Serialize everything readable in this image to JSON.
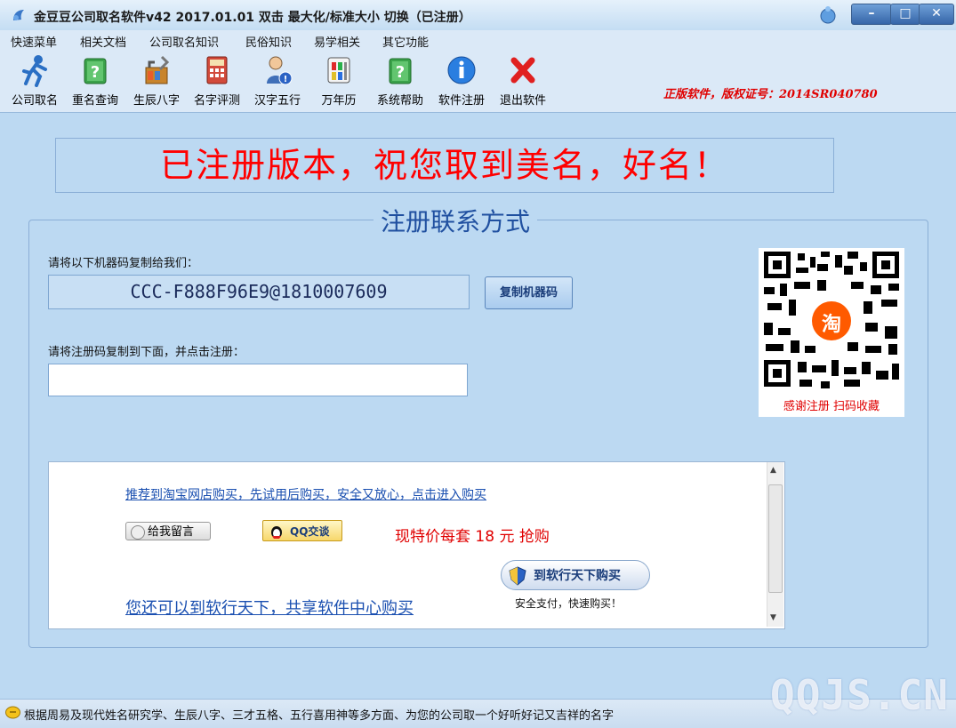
{
  "window": {
    "title": "金豆豆公司取名软件v42   2017.01.01  双击 最大化/标准大小 切换（已注册）"
  },
  "menu": [
    "快速菜单",
    "相关文档",
    "公司取名知识",
    "民俗知识",
    "易学相关",
    "其它功能"
  ],
  "toolbar": {
    "items": [
      {
        "label": "公司取名",
        "icon": "runner-icon"
      },
      {
        "label": "重名查询",
        "icon": "green-book-icon"
      },
      {
        "label": "生辰八字",
        "icon": "tools-icon"
      },
      {
        "label": "名字评测",
        "icon": "calculator-icon"
      },
      {
        "label": "汉字五行",
        "icon": "user-info-icon"
      },
      {
        "label": "万年历",
        "icon": "calendar-icon"
      },
      {
        "label": "系统帮助",
        "icon": "help-book-icon"
      },
      {
        "label": "软件注册",
        "icon": "info-icon"
      },
      {
        "label": "退出软件",
        "icon": "red-x-icon"
      }
    ],
    "copyright": "正版软件，版权证号：2014SR040780"
  },
  "banner": "已注册版本，祝您取到美名，好名！",
  "register": {
    "group_title": "注册联系方式",
    "machine_label": "请将以下机器码复制给我们：",
    "machine_code": "CCC-F888F96E9@1810007609",
    "copy_button": "复制机器码",
    "reg_label": "请将注册码复制到下面，并点击注册：",
    "reg_value": "",
    "qr_caption": "感谢注册   扫码收藏",
    "qr_center": "淘"
  },
  "panel": {
    "taobao_link": "推荐到淘宝网店购买，先试用后购买，安全又放心，点击进入购买",
    "message_button": "给我留言",
    "qq_button": "QQ交谈",
    "price_text": "现特价每套 18 元 抢购",
    "buy_button": "到软行天下购买",
    "buy_sub": "安全支付，快速购买！",
    "rjtx_link": "您还可以到软行天下，共享软件中心购买"
  },
  "status": {
    "text": "根据周易及现代姓名研究学、生辰八字、三才五格、五行喜用神等多方面、为您的公司取一个好听好记又吉祥的名字"
  },
  "watermark": "QQJS.CN",
  "colors": {
    "window_bg": "#bcd9f2",
    "accent_red": "#ff0000",
    "link_blue": "#1a4fb0",
    "title_blue": "#2050a0"
  }
}
